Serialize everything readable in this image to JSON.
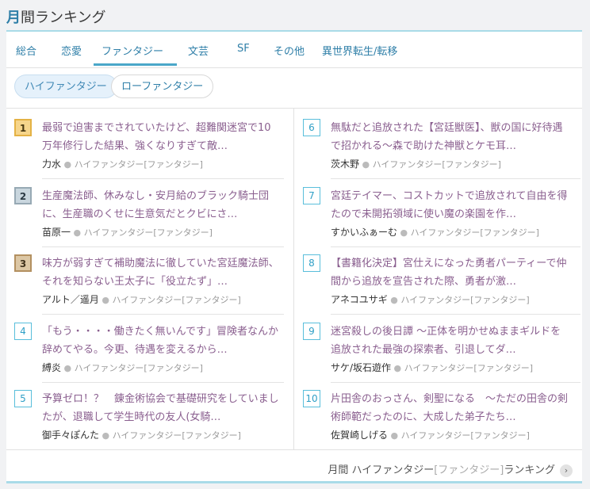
{
  "header": {
    "title_accent": "月",
    "title_rest": "間ランキング"
  },
  "tabs": [
    {
      "label": "総合"
    },
    {
      "label": "恋愛"
    },
    {
      "label": "ファンタジー"
    },
    {
      "label": "文芸"
    },
    {
      "label": "SF"
    },
    {
      "label": "その他"
    },
    {
      "label": "異世界転生/転移"
    }
  ],
  "subtabs": [
    {
      "label": "ハイファンタジー"
    },
    {
      "label": "ローファンタジー"
    }
  ],
  "genre_label": "ハイファンタジー",
  "genre_bracket": "[ファンタジー]",
  "ranking": [
    {
      "rank": "1",
      "title": "最弱で迫害までされていたけど、超難関迷宮で10万年修行した結果、強くなりすぎて敵…",
      "author": "力水"
    },
    {
      "rank": "2",
      "title": "生産魔法師、休みなし・安月給のブラック騎士団に、生産職のくせに生意気だとクビにさ…",
      "author": "苗原一"
    },
    {
      "rank": "3",
      "title": "味方が弱すぎて補助魔法に徹していた宮廷魔法師、それを知らない王太子に「役立たず」…",
      "author": "アルト／遥月"
    },
    {
      "rank": "4",
      "title": "「もう・・・・働きたく無いんです」冒険者なんか辞めてやる。今更、待遇を変えるから…",
      "author": "縛炎"
    },
    {
      "rank": "5",
      "title": "予算ゼロ！？　錬金術協会で基礎研究をしていましたが、退職して学生時代の友人(女騎…",
      "author": "御手々ぽんた"
    },
    {
      "rank": "6",
      "title": "無駄だと追放された【宮廷獣医】、獣の国に好待遇で招かれる～森で助けた神獣とケモ耳…",
      "author": "茨木野"
    },
    {
      "rank": "7",
      "title": "宮廷テイマー、コストカットで追放されて自由を得たので未開拓領域に使い魔の楽園を作…",
      "author": "すかいふぁーむ"
    },
    {
      "rank": "8",
      "title": "【書籍化決定】宮仕えになった勇者パーティーで仲間から追放を宣告された際、勇者が激…",
      "author": "アネコユサギ"
    },
    {
      "rank": "9",
      "title": "迷宮殺しの後日譚 ～正体を明かせぬままギルドを追放された最強の探索者、引退してダ…",
      "author": "サケ/坂石遊作"
    },
    {
      "rank": "10",
      "title": "片田舎のおっさん、剣聖になる　～ただの田舎の剣術師範だったのに、大成した弟子たち…",
      "author": "佐賀崎しげる"
    }
  ],
  "footer": {
    "prefix": "月間 ハイファンタジー",
    "bracket": "[ファンタジー]",
    "suffix": "ランキング"
  }
}
